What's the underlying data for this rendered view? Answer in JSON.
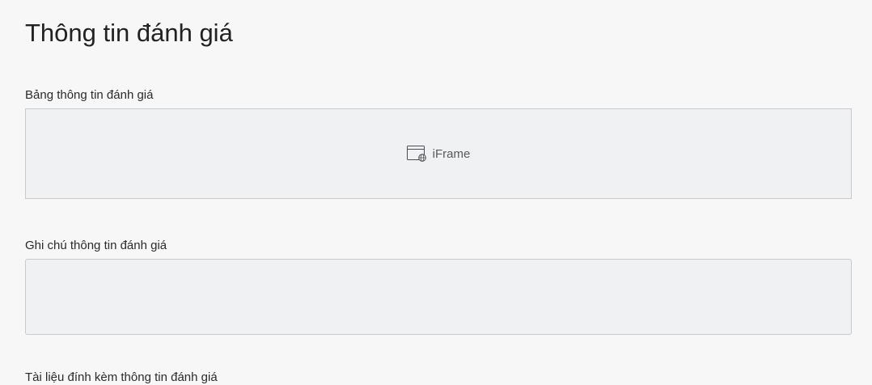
{
  "page": {
    "title": "Thông tin đánh giá"
  },
  "sections": {
    "evaluation_table": {
      "label": "Bảng thông tin đánh giá",
      "iframe_placeholder": "iFrame",
      "icon": "iframe-window-globe-icon"
    },
    "evaluation_note": {
      "label": "Ghi chú thông tin đánh giá",
      "value": ""
    },
    "next_section": {
      "label": "Tài liệu đính kèm thông tin đánh giá"
    }
  },
  "colors": {
    "background": "#f7f7f7",
    "field_background": "#f0f1f3",
    "field_border": "#c8cacd",
    "text": "#222222",
    "placeholder_text": "#555a60"
  }
}
